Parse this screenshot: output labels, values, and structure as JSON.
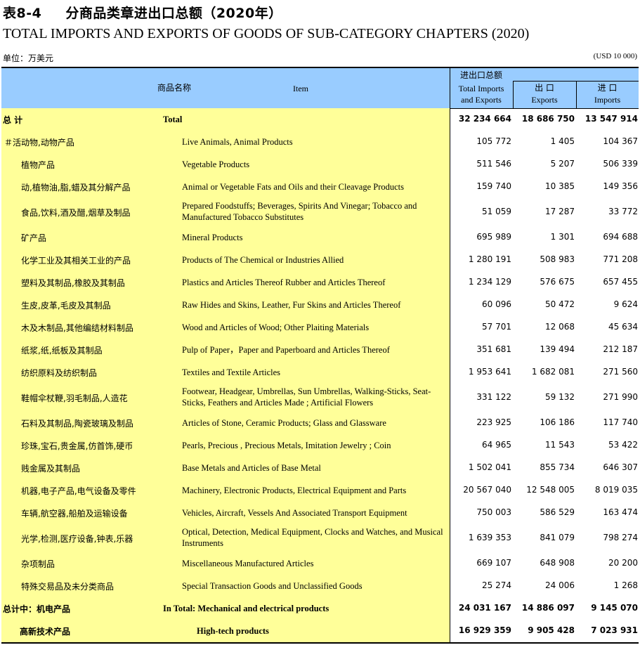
{
  "title": {
    "number": "表8-4",
    "cn": "分商品类章进出口总额（2020年）",
    "en": "TOTAL IMPORTS AND EXPORTS OF GOODS OF SUB-CATEGORY CHAPTERS (2020)"
  },
  "unit": {
    "cn": "单位：万美元",
    "en": "(USD 10 000)"
  },
  "header": {
    "item_cn": "商品名称",
    "item_en": "Item",
    "total_cn": "进出口总额",
    "total_en1": "Total  Imports",
    "total_en2": "and  Exports",
    "exports_cn": "出 口",
    "exports_en": "Exports",
    "imports_cn": "进 口",
    "imports_en": "Imports"
  },
  "rows": [
    {
      "cn": "总 计",
      "en": "Total",
      "total": "32 234 664",
      "exports": "18 686 750",
      "imports": "13 547 914",
      "style": "grand"
    },
    {
      "cn": "＃活动物,动物产品",
      "en": "Live Animals, Animal Products",
      "total": "105 772",
      "exports": "1 405",
      "imports": "104 367",
      "style": "first"
    },
    {
      "cn": "植物产品",
      "en": "Vegetable Products",
      "total": "511 546",
      "exports": "5 207",
      "imports": "506 339"
    },
    {
      "cn": "动,植物油,脂,蜡及其分解产品",
      "en": "Animal or Vegetable Fats and Oils and  their Cleavage Products",
      "total": "159 740",
      "exports": "10 385",
      "imports": "149 356"
    },
    {
      "cn": "食品,饮料,酒及醋,烟草及制品",
      "en": "Prepared Foodstuffs; Beverages, Spirits And Vinegar; Tobacco and Manufactured Tobacco Substitutes",
      "total": "51 059",
      "exports": "17 287",
      "imports": "33 772",
      "tall": true
    },
    {
      "cn": "矿产品",
      "en": "Mineral Products",
      "total": "695 989",
      "exports": "1 301",
      "imports": "694 688"
    },
    {
      "cn": "化学工业及其相关工业的产品",
      "en": "Products of The Chemical or Industries Allied",
      "total": "1 280 191",
      "exports": "508 983",
      "imports": "771 208"
    },
    {
      "cn": "塑料及其制品,橡胶及其制品",
      "en": "Plastics and Articles Thereof Rubber and Articles Thereof",
      "total": "1 234 129",
      "exports": "576 675",
      "imports": "657 455"
    },
    {
      "cn": "生皮,皮革,毛皮及其制品",
      "en": "Raw Hides and Skins, Leather, Fur Skins and Articles Thereof",
      "total": "60 096",
      "exports": "50 472",
      "imports": "9 624"
    },
    {
      "cn": "木及木制品,其他编结材料制品",
      "en": "Wood and Articles of Wood; Other Plaiting Materials",
      "total": "57 701",
      "exports": "12 068",
      "imports": "45 634"
    },
    {
      "cn": "纸浆,纸,纸板及其制品",
      "en": "Pulp of  Paper，Paper and Paperboard and  Articles Thereof",
      "total": "351 681",
      "exports": "139 494",
      "imports": "212 187"
    },
    {
      "cn": "纺织原料及纺织制品",
      "en": "Textiles and Textile Articles",
      "total": "1 953 641",
      "exports": "1 682 081",
      "imports": "271 560"
    },
    {
      "cn": "鞋帽伞杖鞭,羽毛制品,人造花",
      "en": "Footwear, Headgear, Umbrellas, Sun Umbrellas, Walking-Sticks, Seat-Sticks, Feathers and Articles Made ; Artificial Flowers",
      "total": "331 122",
      "exports": "59 132",
      "imports": "271 990",
      "tall": true
    },
    {
      "cn": "石料及其制品,陶瓷玻璃及制品",
      "en": "Articles of Stone, Ceramic Products; Glass and Glassware",
      "total": "223 925",
      "exports": "106 186",
      "imports": "117 740"
    },
    {
      "cn": "珍珠,宝石,贵金属,仿首饰,硬币",
      "en": "Pearls, Precious , Precious Metals, Imitation Jewelry ; Coin",
      "total": "64 965",
      "exports": "11 543",
      "imports": "53 422"
    },
    {
      "cn": "贱金属及其制品",
      "en": "Base Metals and Articles of Base Metal",
      "total": "1 502 041",
      "exports": "855 734",
      "imports": "646 307"
    },
    {
      "cn": "机器,电子产品,电气设备及零件",
      "en": "Machinery, Electronic Products, Electrical  Equipment and Parts",
      "total": "20 567 040",
      "exports": "12 548 005",
      "imports": "8 019 035"
    },
    {
      "cn": "车辆,航空器,船舶及运输设备",
      "en": "Vehicles, Aircraft, Vessels And Associated Transport Equipment",
      "total": "750 003",
      "exports": "586 529",
      "imports": "163 474"
    },
    {
      "cn": "光学,检测,医疗设备,钟表,乐器",
      "en": "Optical, Detection, Medical Equipment, Clocks and Watches, and Musical Instruments",
      "total": "1 639 353",
      "exports": "841 079",
      "imports": "798 274",
      "tall": true
    },
    {
      "cn": "杂项制品",
      "en": "Miscellaneous Manufactured Articles",
      "total": "669 107",
      "exports": "648 908",
      "imports": "20 200"
    },
    {
      "cn": "特殊交易品及未分类商品",
      "en": "Special Transaction Goods and Unclassified Goods",
      "total": "25 274",
      "exports": "24 006",
      "imports": "1 268"
    },
    {
      "cn": "总计中：机电产品",
      "en": "In Total: Mechanical and electrical products",
      "total": "24 031 167",
      "exports": "14 886 097",
      "imports": "9 145 070",
      "style": "sub1"
    },
    {
      "cn": "高新技术产品",
      "en": "High-tech products",
      "total": "16 929 359",
      "exports": "9 905 428",
      "imports": "7 023 931",
      "style": "sub2"
    }
  ]
}
